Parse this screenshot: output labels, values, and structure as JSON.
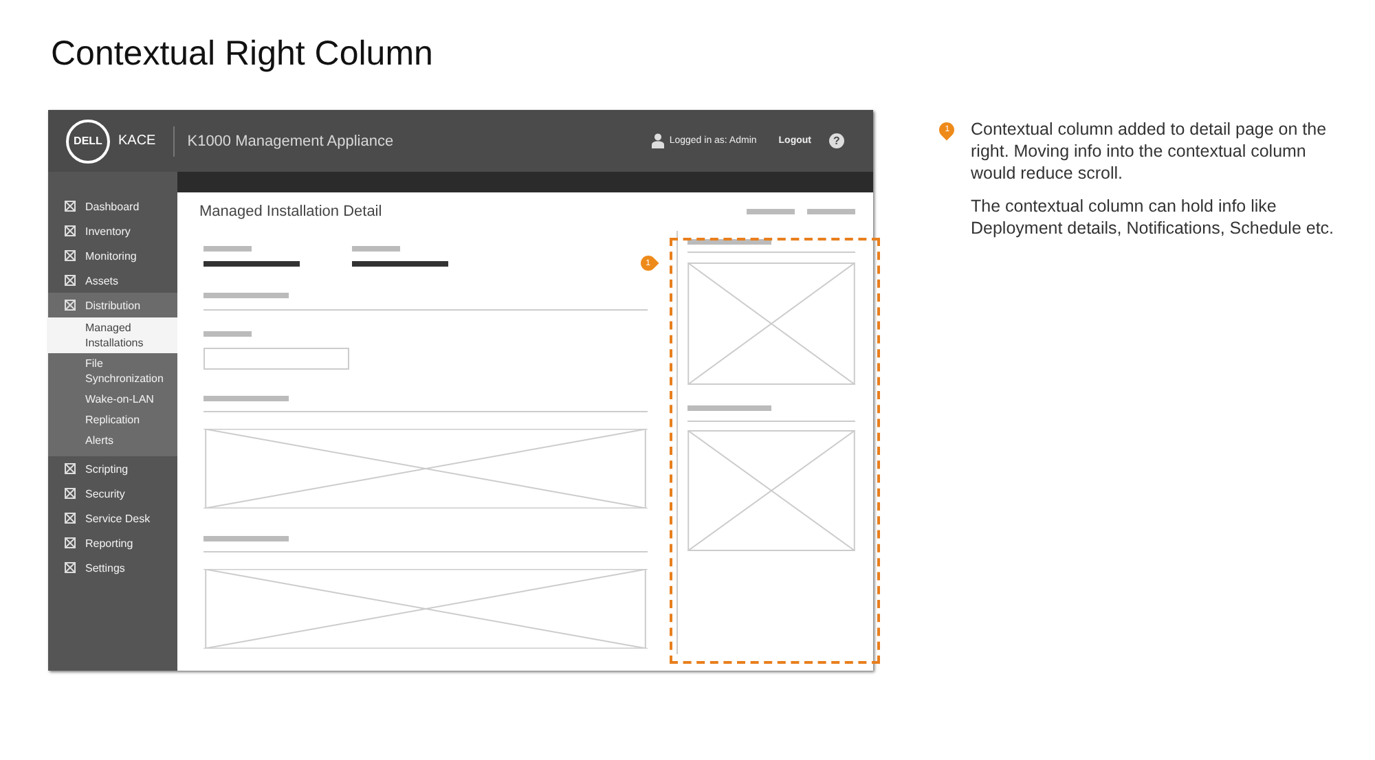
{
  "slide_title": "Contextual Right Column",
  "app": {
    "logo": "DELL",
    "brand": "KACE",
    "title": "K1000 Management Appliance",
    "logged_in": "Logged in as: Admin",
    "logout": "Logout",
    "help": "?"
  },
  "sidebar": {
    "items": [
      {
        "label": "Dashboard",
        "selected": false
      },
      {
        "label": "Inventory",
        "selected": false
      },
      {
        "label": "Monitoring",
        "selected": false
      },
      {
        "label": "Assets",
        "selected": false
      },
      {
        "label": "Distribution",
        "selected": false,
        "expanded": true,
        "children": [
          {
            "label": "Managed Installations",
            "selected": true
          },
          {
            "label": "File Synchronization",
            "selected": false
          },
          {
            "label": "Wake-on-LAN",
            "selected": false
          },
          {
            "label": "Replication",
            "selected": false
          },
          {
            "label": "Alerts",
            "selected": false
          }
        ]
      },
      {
        "label": "Scripting",
        "selected": false
      },
      {
        "label": "Security",
        "selected": false
      },
      {
        "label": "Service Desk",
        "selected": false
      },
      {
        "label": "Reporting",
        "selected": false
      },
      {
        "label": "Settings",
        "selected": false
      }
    ]
  },
  "page": {
    "title": "Managed Installation Detail"
  },
  "callout": {
    "badge": "1"
  },
  "notes": {
    "marker": "1",
    "paragraphs": [
      "Contextual column added to detail page on the right. Moving info into the contextual column would reduce scroll.",
      "The contextual column can hold info like Deployment details, Notifications, Schedule etc."
    ]
  }
}
